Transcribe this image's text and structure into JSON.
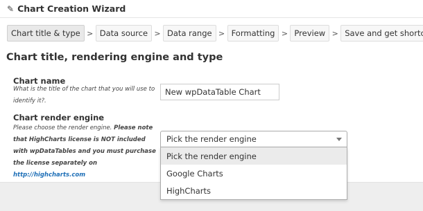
{
  "header": {
    "title": "Chart Creation Wizard",
    "icon": "pencil-icon"
  },
  "steps": [
    {
      "label": "Chart title & type",
      "active": true
    },
    {
      "label": "Data source"
    },
    {
      "label": "Data range"
    },
    {
      "label": "Formatting"
    },
    {
      "label": "Preview"
    },
    {
      "label": "Save and get shortcode"
    }
  ],
  "step_separator": ">",
  "section": {
    "title": "Chart title, rendering engine and type"
  },
  "chart_name": {
    "label": "Chart name",
    "help": "What is the title of the chart that you will use to identify it?.",
    "value": "New wpDataTable Chart"
  },
  "render_engine": {
    "label": "Chart render engine",
    "help_prefix": "Please choose the render engine. ",
    "help_bold": "Please note that HighCharts license is NOT included with wpDataTables and you must purchase the license separately on",
    "help_link": "http://highcharts.com",
    "selected": "Pick the render engine",
    "options": [
      "Pick the render engine",
      "Google Charts",
      "HighCharts"
    ]
  }
}
